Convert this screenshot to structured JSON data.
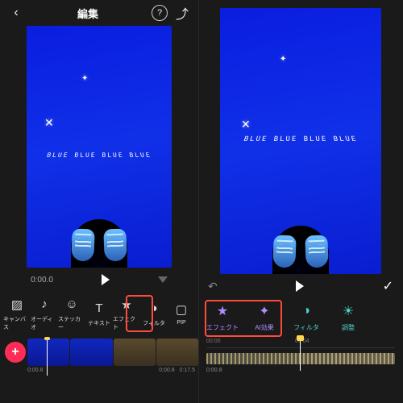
{
  "left": {
    "header": {
      "back": "‹",
      "title": "編集",
      "help": "?",
      "share": "⤴"
    },
    "canvas": {
      "arc_text": "BLUE BLUE BLUE BLUE"
    },
    "tools": [
      {
        "name": "canvas-tool",
        "icon": "▨",
        "label": "キャンバス"
      },
      {
        "name": "audio-tool",
        "icon": "♪",
        "label": "オーディオ"
      },
      {
        "name": "sticker-tool",
        "icon": "☺",
        "label": "ステッカー"
      },
      {
        "name": "text-tool",
        "icon": "T",
        "label": "テキスト"
      },
      {
        "name": "effect-tool",
        "icon": "★",
        "label": "エフェクト"
      },
      {
        "name": "filter-tool",
        "icon": "◑",
        "label": "フィルタ"
      },
      {
        "name": "pip-tool",
        "icon": "▢",
        "label": "PIP"
      }
    ],
    "timeline": {
      "start": "0:00.0",
      "end": "0:00.8",
      "dur_a": "0:00.8",
      "dur_b": "0:17.5"
    }
  },
  "right": {
    "canvas": {
      "arc_text": "BLUE BLUE BLUE BLUE"
    },
    "fx": [
      {
        "name": "fx-effect",
        "icon": "★",
        "label": "エフェクト",
        "cls": "purple"
      },
      {
        "name": "fx-ai",
        "icon": "✦",
        "label": "AI効果",
        "cls": "purple"
      },
      {
        "name": "fx-filter",
        "icon": "◑",
        "label": "フィルタ",
        "cls": "teal"
      },
      {
        "name": "fx-adjust",
        "icon": "☀",
        "label": "調整",
        "cls": "teal"
      }
    ],
    "timeline": {
      "t0": "00:00",
      "t1": "00:04",
      "foot": "0:00.8"
    }
  }
}
